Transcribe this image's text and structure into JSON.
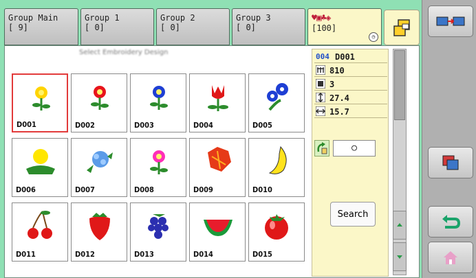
{
  "tabs": [
    {
      "name": "Group Main",
      "count": "[  9]"
    },
    {
      "name": "Group 1",
      "count": "[  0]"
    },
    {
      "name": "Group 2",
      "count": "[  0]"
    },
    {
      "name": "Group 3",
      "count": "[  0]"
    }
  ],
  "design_tab": {
    "icons": "♥▣♣◈",
    "count": "[100]"
  },
  "panel_title": "Select Embroidery Design",
  "designs": [
    {
      "code": "D001",
      "icon": "flower-icon"
    },
    {
      "code": "D002",
      "icon": "flower-icon"
    },
    {
      "code": "D003",
      "icon": "flower-icon"
    },
    {
      "code": "D004",
      "icon": "tulip-icon"
    },
    {
      "code": "D005",
      "icon": "morning-glory-icon"
    },
    {
      "code": "D006",
      "icon": "dandelion-icon"
    },
    {
      "code": "D007",
      "icon": "hydrangea-icon"
    },
    {
      "code": "D008",
      "icon": "flower-icon"
    },
    {
      "code": "D009",
      "icon": "autumn-leaves-icon"
    },
    {
      "code": "D010",
      "icon": "banana-icon"
    },
    {
      "code": "D011",
      "icon": "cherry-icon"
    },
    {
      "code": "D012",
      "icon": "strawberry-icon"
    },
    {
      "code": "D013",
      "icon": "grapes-icon"
    },
    {
      "code": "D014",
      "icon": "watermelon-icon"
    },
    {
      "code": "D015",
      "icon": "tomato-icon"
    }
  ],
  "info": {
    "id_prefix": "004",
    "design_code": "D001",
    "stitches": "810",
    "colors": "3",
    "height": "27.4",
    "width": "15.7",
    "mirror_value": "○"
  },
  "search_label": "Search"
}
